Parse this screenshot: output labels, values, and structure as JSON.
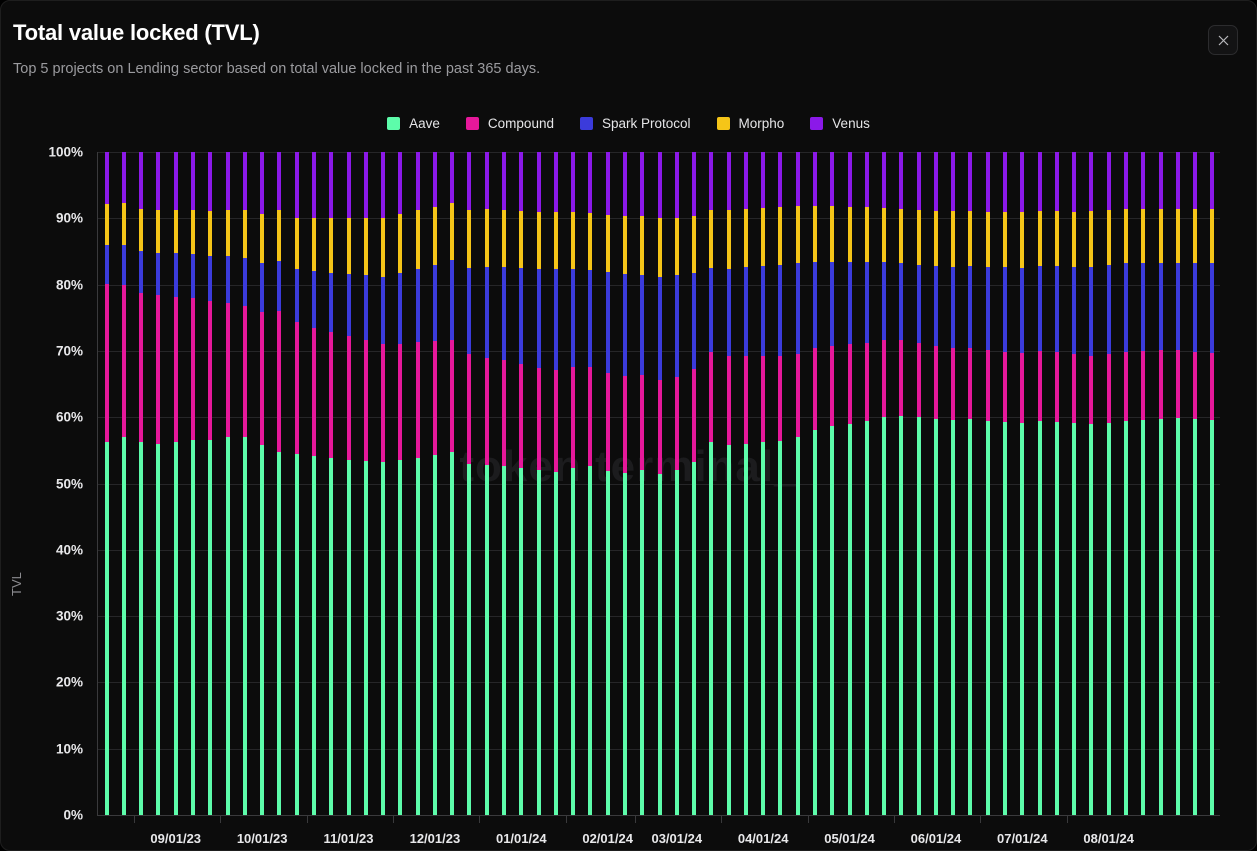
{
  "header": {
    "title": "Total value locked (TVL)",
    "subtitle": "Top 5 projects on Lending sector based on total value locked in the past 365 days.",
    "close_label": "×"
  },
  "watermark": "token terminal_",
  "colors": {
    "background": "#0c0c0c",
    "aave": "#5dfcaa",
    "compound": "#e6189a",
    "spark": "#3b3bdb",
    "morpho": "#f5c518",
    "venus": "#8b19e8",
    "grid": "#262628",
    "axis": "#3a3a3c",
    "text": "#e8e8ea",
    "muted": "#9b9b9f"
  },
  "chart_data": {
    "type": "bar",
    "stacked": true,
    "normalized": true,
    "title": "Total value locked (TVL)",
    "subtitle": "Top 5 projects on Lending sector based on total value locked in the past 365 days.",
    "xlabel": "",
    "ylabel": "TVL",
    "ylim": [
      0,
      100
    ],
    "yticks": [
      "0%",
      "10%",
      "20%",
      "30%",
      "40%",
      "50%",
      "60%",
      "70%",
      "80%",
      "90%",
      "100%"
    ],
    "ytick_values": [
      0,
      10,
      20,
      30,
      40,
      50,
      60,
      70,
      80,
      90,
      100
    ],
    "grid": true,
    "legend_position": "top-center",
    "xticks": [
      "09/01/23",
      "10/01/23",
      "11/01/23",
      "12/01/23",
      "01/01/24",
      "02/01/24",
      "03/01/24",
      "04/01/24",
      "05/01/24",
      "06/01/24",
      "07/01/24",
      "08/01/24"
    ],
    "xtick_indices": [
      4,
      9,
      14,
      19,
      24,
      29,
      33,
      38,
      43,
      48,
      53,
      58
    ],
    "series": [
      {
        "name": "Aave",
        "color": "#5dfcaa",
        "values": [
          56.2,
          57.0,
          56.2,
          56.0,
          56.2,
          56.5,
          56.6,
          57.0,
          57.0,
          55.8,
          54.7,
          54.5,
          54.2,
          53.8,
          53.6,
          53.4,
          53.2,
          53.5,
          53.9,
          54.3,
          54.8,
          53.0,
          52.8,
          52.6,
          52.3,
          52.0,
          51.8,
          52.4,
          52.6,
          51.9,
          51.6,
          52.0,
          51.4,
          52.0,
          53.2,
          56.3,
          55.8,
          56.0,
          56.2,
          56.4,
          57.0,
          58.0,
          58.6,
          59.0,
          59.4,
          60.0,
          60.2,
          60.0,
          59.8,
          59.6,
          59.7,
          59.5,
          59.3,
          59.2,
          59.4,
          59.3,
          59.1,
          59.0,
          59.2,
          59.4,
          59.6,
          59.8,
          59.9,
          59.7,
          59.6
        ]
      },
      {
        "name": "Compound",
        "color": "#e6189a",
        "values": [
          23.9,
          23.0,
          22.6,
          22.4,
          22.0,
          21.5,
          21.0,
          20.3,
          19.8,
          20.0,
          21.3,
          19.8,
          19.3,
          19.0,
          18.6,
          18.2,
          17.8,
          17.6,
          17.4,
          17.2,
          16.9,
          16.5,
          16.2,
          16.0,
          15.8,
          15.5,
          15.3,
          15.2,
          15.0,
          14.8,
          14.6,
          14.4,
          14.2,
          14.0,
          14.0,
          13.6,
          13.4,
          13.2,
          13.0,
          12.8,
          12.6,
          12.4,
          12.2,
          12.0,
          11.8,
          11.6,
          11.4,
          11.2,
          11.0,
          10.9,
          10.8,
          10.7,
          10.6,
          10.5,
          10.6,
          10.5,
          10.4,
          10.3,
          10.4,
          10.5,
          10.4,
          10.3,
          10.2,
          10.2,
          10.1
        ]
      },
      {
        "name": "Spark Protocol",
        "color": "#3b3bdb",
        "values": [
          5.9,
          6.0,
          6.2,
          6.4,
          6.5,
          6.6,
          6.7,
          7.0,
          7.2,
          7.4,
          7.6,
          8.0,
          8.6,
          9.0,
          9.4,
          9.8,
          10.2,
          10.6,
          11.0,
          11.4,
          12.0,
          13.0,
          13.6,
          14.0,
          14.4,
          14.8,
          15.2,
          14.8,
          14.6,
          15.2,
          15.4,
          15.0,
          15.6,
          15.4,
          14.6,
          12.6,
          13.2,
          13.4,
          13.6,
          13.8,
          13.6,
          13.0,
          12.6,
          12.4,
          12.2,
          11.8,
          11.6,
          11.8,
          12.0,
          12.2,
          12.3,
          12.5,
          12.7,
          12.8,
          12.8,
          13.0,
          13.2,
          13.4,
          13.4,
          13.3,
          13.2,
          13.1,
          13.2,
          13.4,
          13.6
        ]
      },
      {
        "name": "Morpho",
        "color": "#f5c518",
        "values": [
          6.2,
          6.3,
          6.4,
          6.5,
          6.6,
          6.6,
          6.8,
          7.0,
          7.2,
          7.4,
          7.6,
          7.8,
          8.0,
          8.2,
          8.4,
          8.6,
          8.8,
          8.9,
          8.9,
          8.8,
          8.6,
          8.8,
          8.8,
          8.7,
          8.6,
          8.7,
          8.7,
          8.6,
          8.6,
          8.6,
          8.7,
          8.9,
          8.8,
          8.7,
          8.6,
          8.7,
          8.8,
          8.8,
          8.8,
          8.7,
          8.6,
          8.4,
          8.4,
          8.3,
          8.3,
          8.2,
          8.2,
          8.2,
          8.3,
          8.4,
          8.3,
          8.3,
          8.3,
          8.4,
          8.3,
          8.3,
          8.3,
          8.4,
          8.3,
          8.2,
          8.2,
          8.2,
          8.1,
          8.1,
          8.1
        ]
      },
      {
        "name": "Venus",
        "color": "#8b19e8",
        "values": [
          7.8,
          7.7,
          8.6,
          8.7,
          8.7,
          8.8,
          8.9,
          8.7,
          8.8,
          9.4,
          8.8,
          9.9,
          9.9,
          10.0,
          10.0,
          10.0,
          10.0,
          9.4,
          8.8,
          8.3,
          7.7,
          8.7,
          8.6,
          8.7,
          8.9,
          9.0,
          9.0,
          9.0,
          9.2,
          9.5,
          9.7,
          9.7,
          10.0,
          9.9,
          9.6,
          8.8,
          8.8,
          8.6,
          8.4,
          8.3,
          8.2,
          8.2,
          8.2,
          8.3,
          8.3,
          8.4,
          8.6,
          8.8,
          8.9,
          8.9,
          8.9,
          9.0,
          9.1,
          9.1,
          8.9,
          8.9,
          9.0,
          8.9,
          8.7,
          8.6,
          8.6,
          8.6,
          8.6,
          8.6,
          8.6
        ]
      }
    ]
  }
}
